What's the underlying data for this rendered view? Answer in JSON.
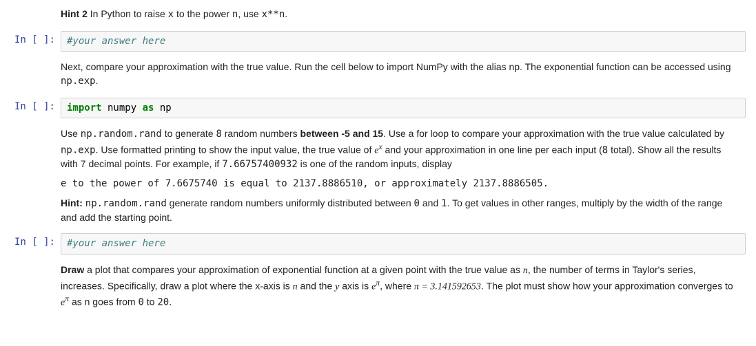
{
  "prompt_label": "In [ ]:",
  "hint2": {
    "label": "Hint 2",
    "text_a": " In Python to raise ",
    "x": "x",
    "text_b": " to the power ",
    "n": "n",
    "text_c": ", use ",
    "code": "x**n",
    "text_d": "."
  },
  "cell1": {
    "comment": "#your answer here"
  },
  "para1": {
    "text_a": "Next, compare your approximation with the true value. Run the cell below to import NumPy with the alias np. The exponential function can be accessed using ",
    "code": "np.exp",
    "text_b": "."
  },
  "cell2": {
    "kw_import": "import",
    "numpy": " numpy ",
    "kw_as": "as",
    "np": " np"
  },
  "para2": {
    "a": "Use ",
    "rand": "np.random.rand",
    "b": " to generate ",
    "eight1": "8",
    "c": " random numbers ",
    "between": "between -5 and 15",
    "d": ". Use a for loop to compare your approximation with the true value calculated by ",
    "npexp": "np.exp",
    "e": ". Use formatted printing to show the input value, the true value of ",
    "ex_e": "e",
    "ex_x": "x",
    "f": " and your approximation in one line per each input (",
    "eight2": "8",
    "g": " total). Show all the results with 7 decimal points. For example, if ",
    "randval": "7.66757400932",
    "h": " is one of the random inputs, display"
  },
  "example_output": "e to the power of 7.6675740 is equal to 2137.8886510, or approximately 2137.8886505.",
  "hint3": {
    "label": "Hint:",
    "a": " ",
    "rand": "np.random.rand",
    "b": " generate random numbers uniformly distributed between ",
    "zero": "0",
    "c": " and ",
    "one": "1",
    "d": ". To get values in other ranges, multiply by the width of the range and add the starting point."
  },
  "cell3": {
    "comment": "#your answer here"
  },
  "para3": {
    "draw": "Draw",
    "a": " a plot that compares your approximation of exponential function at a given point with the true value as ",
    "n1": "n",
    "b": ", the number of terms in Taylor's series, increases. Specifically, draw a plot where the x-axis is ",
    "n2": "n",
    "c": " and the ",
    "y": "y",
    "d": " axis is ",
    "e1": "e",
    "pi1": "π",
    "e_": ", where ",
    "pieq": "π = 3.141592653",
    "f": ". The plot must show how your approximation converges to ",
    "e2": "e",
    "pi2": "π",
    "g": " as n goes from ",
    "zero": "0",
    "h": " to ",
    "twenty": "20",
    "i": "."
  }
}
